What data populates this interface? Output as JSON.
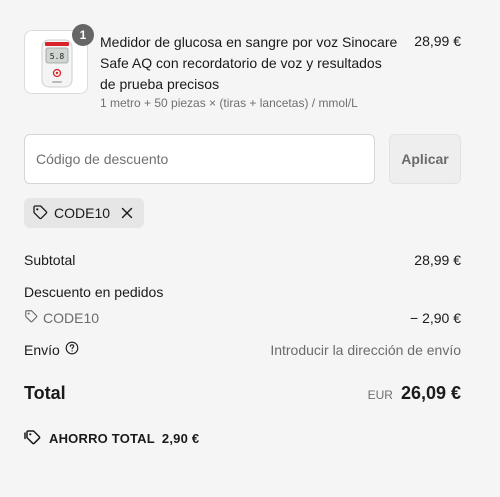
{
  "product": {
    "quantity": "1",
    "title": "Medidor de glucosa en sangre por voz Sinocare Safe AQ con recordatorio de voz y resultados de prueba precisos",
    "variant": "1 metro + 50 piezas × (tiras + lancetas) / mmol/L",
    "price": "28,99 €",
    "device_display": "5.8",
    "device_brand": "Sinocare"
  },
  "discount": {
    "placeholder": "Código de descuento",
    "value": "",
    "apply_label": "Aplicar",
    "applied_code": "CODE10"
  },
  "summary": {
    "subtotal_label": "Subtotal",
    "subtotal_value": "28,99 €",
    "order_discount_label": "Descuento en pedidos",
    "discount_code": "CODE10",
    "discount_value": "− 2,90 €",
    "shipping_label": "Envío",
    "shipping_value": "Introducir la dirección de envío",
    "total_label": "Total",
    "currency": "EUR",
    "total_value": "26,09 €",
    "savings_label": "AHORRO TOTAL",
    "savings_value": "2,90 €"
  },
  "icons": {
    "tag": "tag-icon",
    "close": "close-icon",
    "help": "help-circle-icon",
    "savings": "savings-tag-icon"
  }
}
